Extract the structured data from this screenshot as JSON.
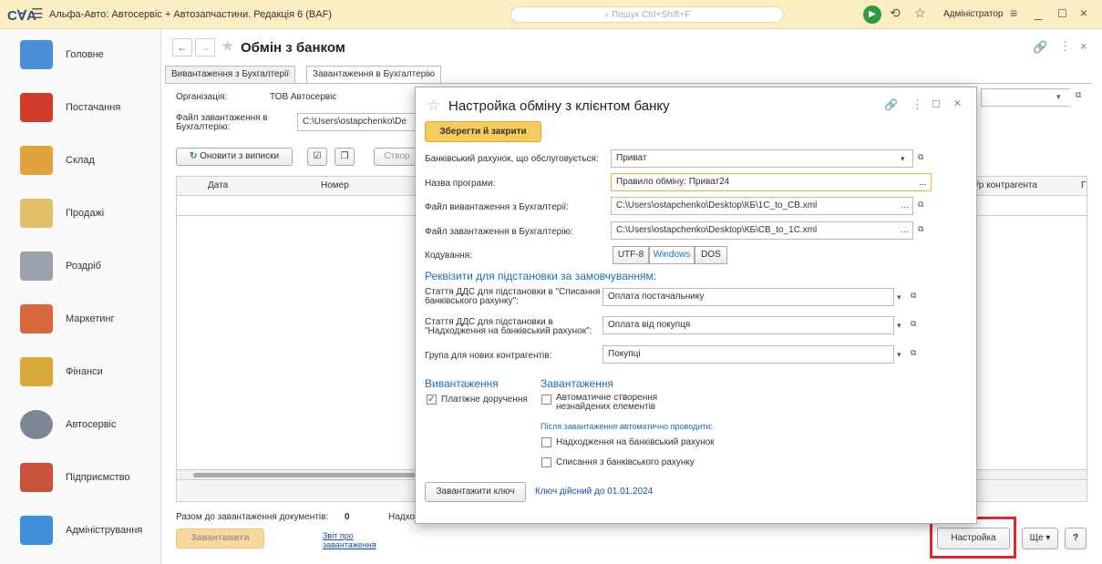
{
  "topbar": {
    "logo": "CꓯA",
    "app_title": "Альфа-Авто: Автосервіс + Автозапчастини. Редакція 6 (BAF)",
    "search_placeholder": "Пошук Ctrl+Shift+F",
    "user": "Адміністратор"
  },
  "sidebar": {
    "items": [
      {
        "label": "Головне",
        "color": "#4a8fd8"
      },
      {
        "label": "Постачання",
        "color": "#d03c2a"
      },
      {
        "label": "Склад",
        "color": "#e2a23a"
      },
      {
        "label": "Продажі",
        "color": "#e2c06a"
      },
      {
        "label": "Роздріб",
        "color": "#9aa3ad"
      },
      {
        "label": "Маркетинг",
        "color": "#d7673c"
      },
      {
        "label": "Фінанси",
        "color": "#d8a83a"
      },
      {
        "label": "Автосервіс",
        "color": "#7d8794"
      },
      {
        "label": "Підприємство",
        "color": "#c9523a"
      },
      {
        "label": "Адміністрування",
        "color": "#3f8fd9"
      }
    ]
  },
  "main": {
    "title": "Обмін з банком",
    "tabs": [
      "Вивантаження з Бухгалтерії",
      "Завантаження в Бухгалтерію"
    ],
    "org_label": "Організація:",
    "org_value": "ТОВ Автосервіс",
    "file_label": "Файл завантаження в Бухгалтерію:",
    "file_value": "C:\\Users\\ostapchenko\\De",
    "refresh_btn": "Оновити з виписки",
    "create_btn": "Створ",
    "col_date": "Дата",
    "col_number": "Номер",
    "col_contractor": "/р контрагента",
    "col_last": "Г",
    "total_label": "Разом до завантаження документів:",
    "total_value": "0",
    "received_label": "Надхо",
    "load_btn": "Завантажити",
    "report_link": "Звіт про завантаження",
    "settings_btn": "Настройка",
    "more_btn": "Ще",
    "help_btn": "?"
  },
  "dialog": {
    "title": "Настройка обміну з клієнтом банку",
    "save_btn": "Зберегти й закрити",
    "bank_account_label": "Банківський рахунок, що обслуговується:",
    "bank_account_value": "Приват",
    "program_label": "Назва програми:",
    "program_value": "Правило обміну: Приват24",
    "export_file_label": "Файл вивантаження з Бухгалтерії:",
    "export_file_value": "C:\\Users\\ostapchenko\\Desktop\\КБ\\1C_to_CB.xml",
    "import_file_label": "Файл завантаження в Бухгалтерію:",
    "import_file_value": "C:\\Users\\ostapchenko\\Desktop\\КБ\\CB_to_1C.xml",
    "encoding_label": "Кодування:",
    "encodings": [
      "UTF-8",
      "Windows",
      "DOS"
    ],
    "selected_encoding": "Windows",
    "defaults_heading": "Реквізити для підстановки за замовчуванням:",
    "dds_out_label": "Стаття ДДС для підстановки в \"Списання з банківського рахунку\":",
    "dds_out_value": "Оплата постачальнику",
    "dds_in_label": "Стаття ДДС для підстановки в \"Надходження на банківський рахунок\":",
    "dds_in_value": "Оплата від покупця",
    "group_label": "Група для нових контрагентів:",
    "group_value": "Покупці",
    "export_heading": "Вивантаження",
    "payment_order_label": "Платіжне доручення",
    "import_heading": "Завантаження",
    "auto_create_label": "Автоматичне створення незнайдених елементів",
    "after_import_label": "Після завантаження автоматично проводити:",
    "receipt_label": "Надходження на банківський рахунок",
    "writeoff_label": "Списання з банківського рахунку",
    "load_key_btn": "Завантажити ключ",
    "key_valid": "Ключ дійсний до 01.01.2024"
  }
}
